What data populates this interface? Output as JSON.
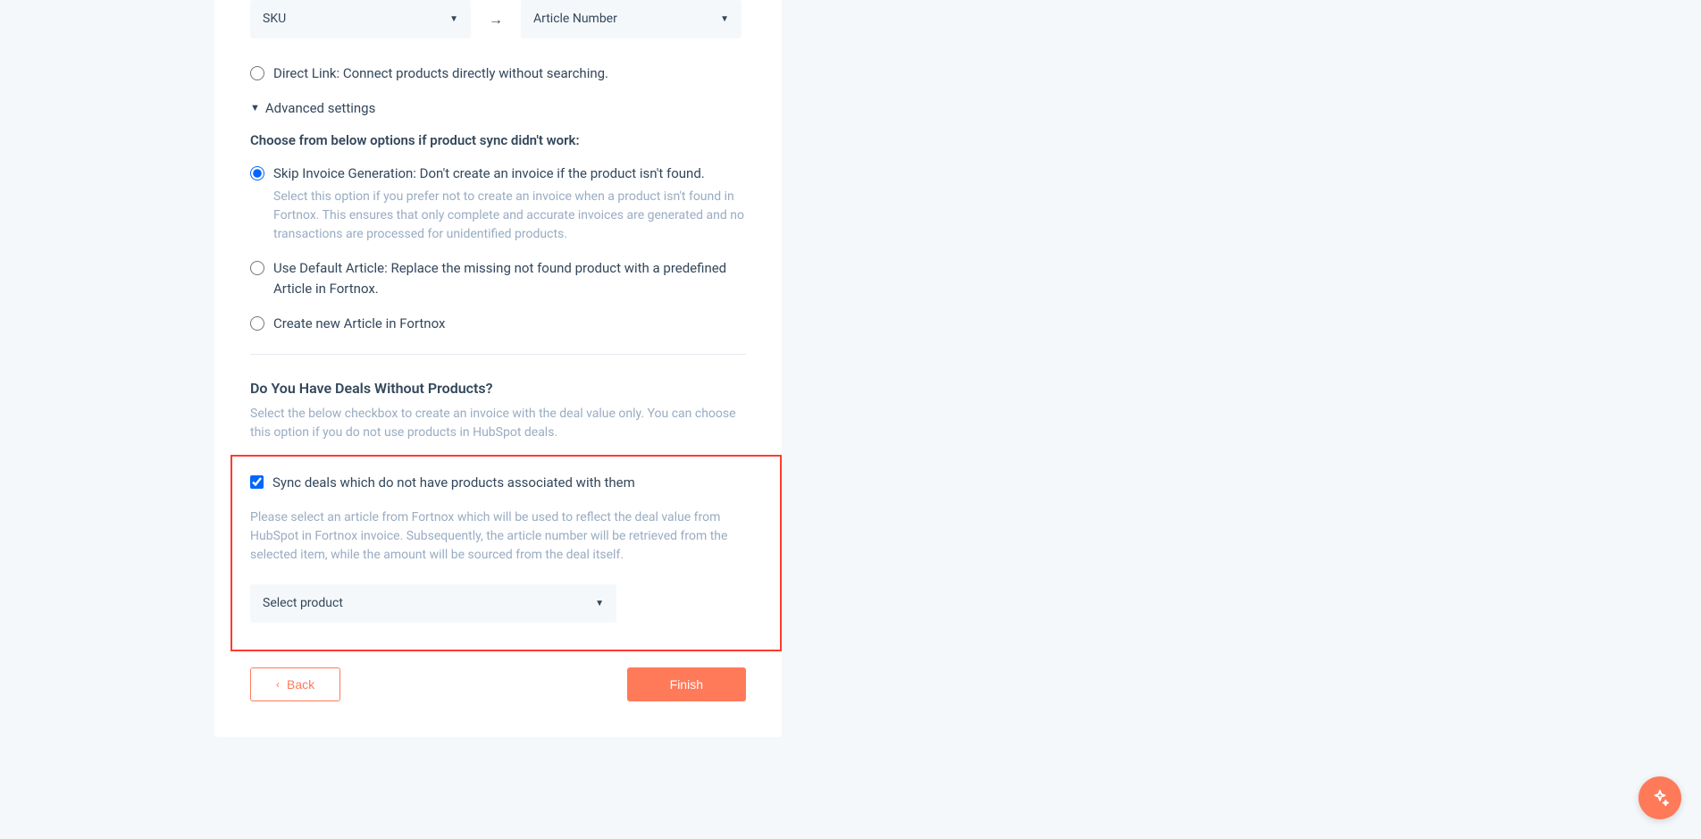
{
  "mapping": {
    "source_dropdown": "SKU",
    "target_dropdown": "Article Number"
  },
  "direct_link": {
    "label": "Direct Link: Connect products directly without searching."
  },
  "advanced": {
    "toggle_label": "Advanced settings",
    "heading": "Choose from below options if product sync didn't work:",
    "skip_invoice": {
      "label": "Skip Invoice Generation: Don't create an invoice if the product isn't found.",
      "desc": "Select this option if you prefer not to create an invoice when a product isn't found in Fortnox. This ensures that only complete and accurate invoices are generated and no transactions are processed for unidentified products."
    },
    "default_article": {
      "label": "Use Default Article: Replace the missing not found product with a predefined Article in Fortnox."
    },
    "create_article": {
      "label": "Create new Article in Fortnox"
    }
  },
  "deals_section": {
    "heading": "Do You Have Deals Without Products?",
    "desc": "Select the below checkbox to create an invoice with the deal value only. You can choose this option if you do not use products in HubSpot deals.",
    "checkbox_label": "Sync deals which do not have products associated with them",
    "highlighted_desc": "Please select an article from Fortnox which will be used to reflect the deal value from HubSpot in Fortnox invoice. Subsequently, the article number will be retrieved from the selected item, while the amount will be sourced from the deal itself.",
    "product_dropdown": "Select product"
  },
  "buttons": {
    "back": "Back",
    "finish": "Finish"
  }
}
